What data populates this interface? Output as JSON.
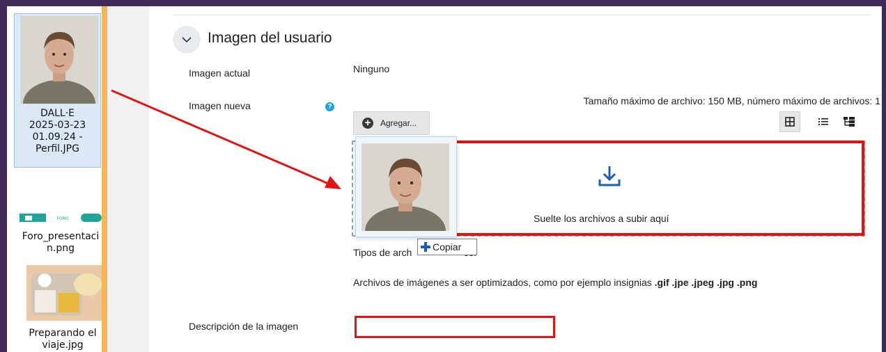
{
  "desktop": {
    "files": [
      {
        "name": "DALL·E\n2025-03-23\n01.09.24 -\nPerfil.JPG",
        "selected": true
      },
      {
        "name": "Foro_presentaci\nn.png",
        "thumb_text": "FORO"
      },
      {
        "name": "Preparando el\nviaje.jpg"
      }
    ]
  },
  "section": {
    "title": "Imagen del usuario",
    "toggle_icon": "chevron-down-icon"
  },
  "fields": {
    "current_image_label": "Imagen actual",
    "current_image_value": "Ninguno",
    "new_image_label": "Imagen nueva",
    "help_glyph": "?",
    "limits_text": "Tamaño máximo de archivo: 150 MB, número máximo de archivos: 1",
    "add_button_label": "Agregar...",
    "add_glyph": "+",
    "drop_text": "Suelte los archivos a subir aquí",
    "types_prefix": "Tipos de arch",
    "types_suffix": "os:",
    "types_desc_text": "Archivos de imágenes a ser optimizados, como por ejemplo insignias ",
    "types_desc_ext": ".gif .jpe .jpeg .jpg .png",
    "description_label": "Descripción de la imagen"
  },
  "drag": {
    "tooltip_label": "Copiar"
  },
  "colors": {
    "highlight": "#e01414",
    "frame": "#3f2a5a",
    "accent_orange": "#f4b859",
    "help_blue": "#1aa3e8",
    "copy_blue": "#1a5fb4"
  }
}
